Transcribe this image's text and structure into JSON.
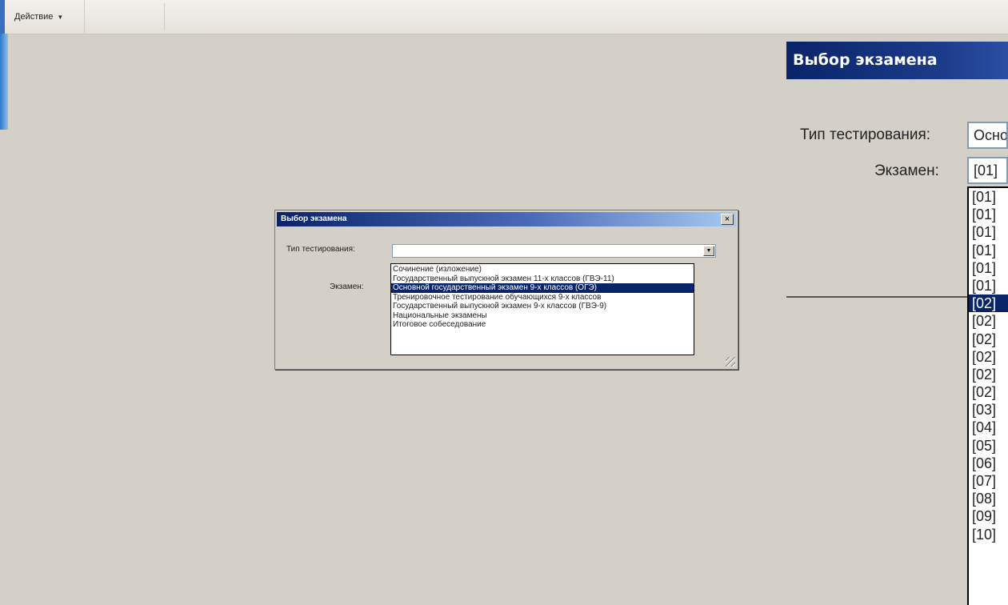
{
  "toolbar": {
    "action_label": "Действие"
  },
  "dialog": {
    "title": "Выбор экзамена",
    "close_glyph": "×",
    "test_type_label": "Тип тестирования:",
    "exam_label": "Экзамен:",
    "options": [
      "Сочинение (изложение)",
      "Государственный выпускной экзамен 11-х классов (ГВЭ-11)",
      "Основной государственный экзамен 9-х классов (ОГЭ)",
      "Тренировочное тестирование обучающихся 9-х классов",
      "Государственный выпускной экзамен 9-х классов (ГВЭ-9)",
      "Национальные экзамены",
      "Итоговое собеседование"
    ],
    "selected_option": "Основной государственный экзамен 9-х классов (ОГЭ)"
  },
  "zoom": {
    "title": "Выбор экзамена",
    "test_type_label": "Тип тестирования:",
    "test_type_value": "Осно",
    "exam_label": "Экзамен:",
    "exam_value": "[01]",
    "list_items": [
      "[01]",
      "[01]",
      "[01]",
      "[01]",
      "[01]",
      "[01]",
      "[02]",
      "[02]",
      "[02]",
      "[02]",
      "[02]",
      "[02]",
      "[03]",
      "[04]",
      "[05]",
      "[06]",
      "[07]",
      "[08]",
      "[09]",
      "[10]"
    ],
    "selected_item": "[02]"
  },
  "colors": {
    "titlebar": "#0a246a",
    "selection": "#0a246a",
    "background": "#d4d0c8"
  }
}
